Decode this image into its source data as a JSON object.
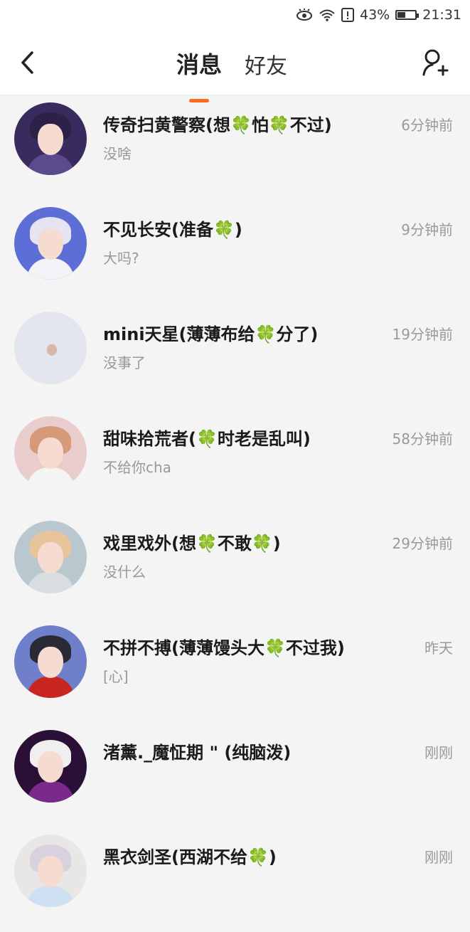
{
  "status": {
    "battery_pct": "43%",
    "time": "21:31",
    "icons": [
      "eye-icon",
      "wifi-icon",
      "alert-icon",
      "battery-icon"
    ]
  },
  "header": {
    "tabs": [
      {
        "label": "消息",
        "active": true
      },
      {
        "label": "好友",
        "active": false
      }
    ]
  },
  "messages": [
    {
      "name": "传奇扫黄警察(想🍀怕🍀不过)",
      "preview": "没啥",
      "time": "6分钟前",
      "colors": {
        "bg": "#3a2b5e",
        "hair": "#2d2148",
        "body": "#5b4a8c"
      }
    },
    {
      "name": "不见长安(准备🍀)",
      "preview": "大吗?",
      "time": "9分钟前",
      "colors": {
        "bg": "#5d6fd6",
        "hair": "#e6e3f2",
        "body": "#f4f2f7"
      }
    },
    {
      "name": "mini天星(薄薄布给🍀分了)",
      "preview": "没事了",
      "time": "19分钟前",
      "colors": {
        "bg": "#e3e6ee",
        "hair": "#e3e6ee",
        "body": "#e3e6ee"
      }
    },
    {
      "name": "甜味拾荒者(🍀时老是乱叫)",
      "preview": "不给你cha",
      "time": "58分钟前",
      "colors": {
        "bg": "#e9cdcd",
        "hair": "#d69a7a",
        "body": "#f4f4f4"
      }
    },
    {
      "name": "戏里戏外(想🍀不敢🍀)",
      "preview": "没什么",
      "time": "29分钟前",
      "colors": {
        "bg": "#b9c7cf",
        "hair": "#e9c49a",
        "body": "#d8dde0"
      }
    },
    {
      "name": "不拼不搏(薄薄馒头大🍀不过我)",
      "preview": "[心]",
      "time": "昨天",
      "colors": {
        "bg": "#6f7fc9",
        "hair": "#2a2a36",
        "body": "#c8261e"
      }
    },
    {
      "name": "渚薰._魔怔期 \" (纯脑泼)",
      "preview": "",
      "time": "刚刚",
      "colors": {
        "bg": "#2a1036",
        "hair": "#f1eef0",
        "body": "#7a2a8a"
      }
    },
    {
      "name": "黑衣剑圣(西湖不给🍀)",
      "preview": "",
      "time": "刚刚",
      "colors": {
        "bg": "#e9e7e6",
        "hair": "#d8d2df",
        "body": "#cfe0f2"
      }
    }
  ]
}
